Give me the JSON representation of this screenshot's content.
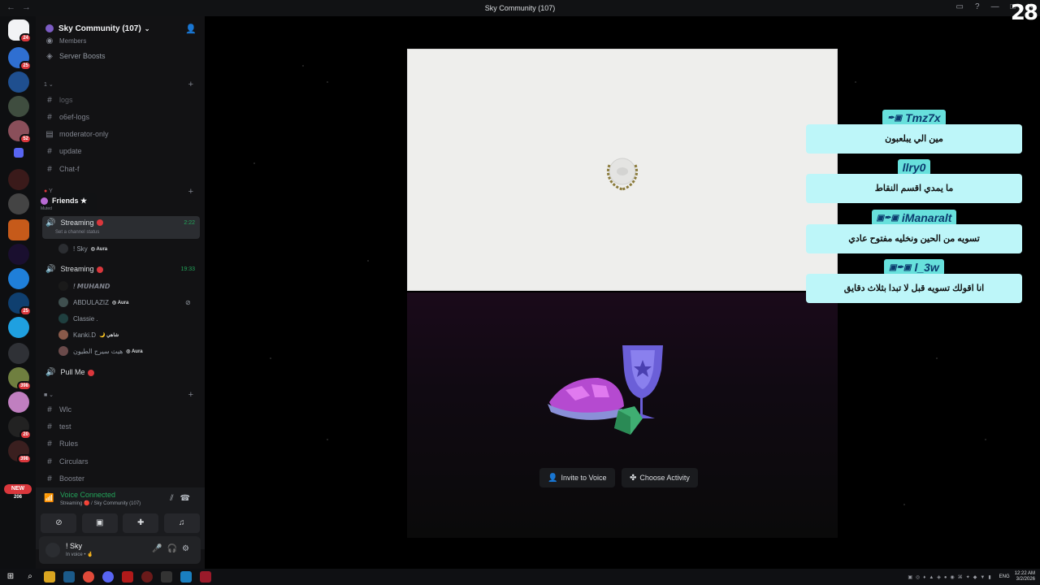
{
  "window": {
    "title": "Sky Community (107)",
    "nav_back": "←",
    "nav_forward": "→"
  },
  "guild_badges": [
    "24",
    "25",
    "52",
    "25",
    "398",
    "20",
    "398",
    "206"
  ],
  "new_label": "NEW",
  "server": {
    "name": "Sky Community (107)",
    "boosts": "Server Boosts",
    "members_label": "Members"
  },
  "categories": {
    "one": "1",
    "two": "Y",
    "three": "■"
  },
  "channels": {
    "logs": "logs",
    "o6ef_logs": "o6ef-logs",
    "moderator_only": "moderator-only",
    "update": "update",
    "chat_f": "Chat-f",
    "wlc": "Wlc",
    "test": "test",
    "rules": "Rules",
    "circulars": "Circulars",
    "booster": "Booster"
  },
  "tooltip": {
    "name": "Friends ★",
    "status": "Muted"
  },
  "voice": {
    "streaming1": {
      "name": "Streaming",
      "time": "2:22",
      "status": "Set a channel status"
    },
    "streaming2": {
      "name": "Streaming",
      "time": "19:33"
    },
    "pull_me": "Pull Me"
  },
  "members": {
    "sky": "! Sky",
    "muhand": "! 𝙈𝙐𝙃𝘼𝙉𝘿",
    "abdulaziz": "ABDULAZIZ",
    "classie": "Classie .",
    "kanki": "Kanki.D",
    "kanki_tag": "شاهي",
    "arabic": "هيث سيرج الطيون",
    "aura": "Aura"
  },
  "voice_panel": {
    "connected": "Voice Connected",
    "details": "Streaming 🔴 / Sky Community (107)"
  },
  "user": {
    "name": "! Sky",
    "status": "In voice • 🤞"
  },
  "activity": {
    "invite": "Invite to Voice",
    "choose": "Choose Activity"
  },
  "chat": [
    {
      "user": "Tmz7x",
      "message": "مين الي يبلعبون"
    },
    {
      "user": "llry0",
      "message": "ما يمدي اقسم النقاط"
    },
    {
      "user": "iManaralt",
      "message": "تسويه من الحين ونخليه مفتوح عادي"
    },
    {
      "user": "l_3w",
      "message": "انا اقولك تسويه قبل لا تبدا بثلاث دقايق"
    }
  ],
  "overlay_logo": "28",
  "taskbar": {
    "lang": "ENG",
    "time": "12:22 AM",
    "date": "3/2/2026"
  },
  "colors": {
    "online": "#23a55a",
    "live": "#da373c",
    "chat_name_bg": "#67e0dc",
    "chat_msg_bg": "#bdf6f9"
  }
}
